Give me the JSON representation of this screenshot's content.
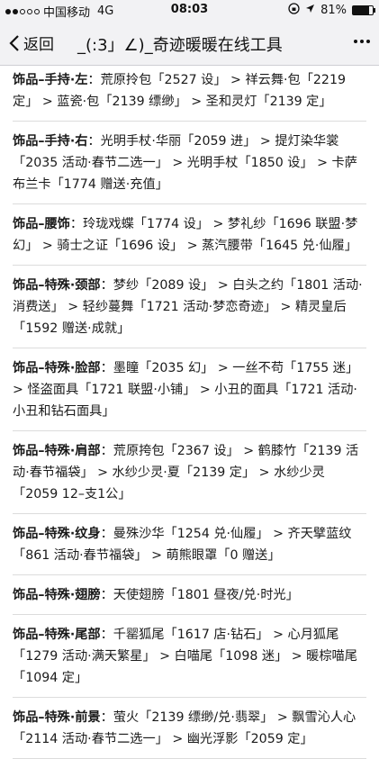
{
  "status_bar": {
    "carrier": "中国移动",
    "network": "4G",
    "time": "08:03",
    "battery_percent": "81%",
    "battery_level": 0.81
  },
  "nav": {
    "back_label": "返回",
    "title": "_(:3」∠)_奇迹暖暖在线工具"
  },
  "entries": [
    {
      "head": "饰品–手持·左",
      "body": "：荒原拎包「2527 设」 > 祥云舞·包「2219 定」 > 蓝瓷·包「2139 缥缈」 > 圣和灵灯「2139 定」"
    },
    {
      "head": "饰品–手持·右",
      "body": "：光明手杖·华丽「2059 进」 > 提灯染华裳「2035 活动·春节二选一」 > 光明手杖「1850 设」 > 卡萨布兰卡「1774 赠送·充值」"
    },
    {
      "head": "饰品–腰饰",
      "body": "：玲珑戏蝶「1774 设」 > 梦礼纱「1696 联盟·梦幻」 > 骑士之证「1696 设」 > 蒸汽腰带「1645 兑·仙履」"
    },
    {
      "head": "饰品–特殊·颈部",
      "body": "：梦纱「2089 设」 > 白头之约「1801 活动·消费送」 > 轻纱蔓舞「1721 活动·梦恋奇迹」 > 精灵皇后「1592 赠送·成就」"
    },
    {
      "head": "饰品–特殊·脸部",
      "body": "：墨瞳「2035 幻」 > 一丝不苟「1755 迷」 > 怪盗面具「1721 联盟·小铺」 > 小丑的面具「1721 活动·小丑和钻石面具」"
    },
    {
      "head": "饰品–特殊·肩部",
      "body": "：荒原挎包「2367 设」 > 鹤膝竹「2139 活动·春节福袋」 > 水纱少灵·夏「2139 定」 > 水纱少灵「2059 12–支1公」"
    },
    {
      "head": "饰品–特殊·纹身",
      "body": "：曼殊沙华「1254 兑·仙履」 > 齐天擘蓝纹「861 活动·春节福袋」 > 萌熊眼罩「0 赠送」"
    },
    {
      "head": "饰品–特殊·翅膀",
      "body": "：天使翅膀「1801 昼夜/兑·时光」"
    },
    {
      "head": "饰品–特殊·尾部",
      "body": "：千罂狐尾「1617 店·钻石」 > 心月狐尾「1279 活动·满天繁星」 > 白喵尾「1098 迷」 > 暖棕喵尾「1094 定」"
    },
    {
      "head": "饰品–特殊·前景",
      "body": "：萤火「2139 缥缈/兑·翡翠」 > 飘雪沁人心「2114 活动·春节二选一」 > 幽光浮影「2059 定」"
    }
  ]
}
